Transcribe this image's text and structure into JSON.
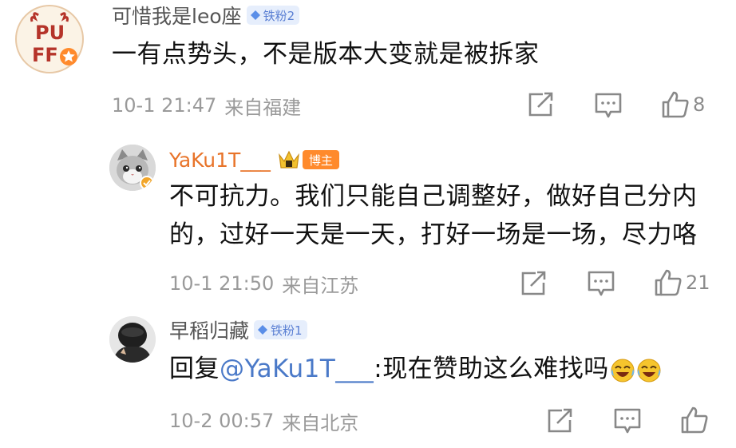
{
  "comments": [
    {
      "username": "可惜我是leo座",
      "fan_badge": "铁粉2",
      "avatar_text": "PUFF",
      "text": "一有点势头，不是版本大变就是被拆家",
      "time": "10-1 21:47",
      "location": "来自福建",
      "like_count": "8"
    },
    {
      "username": "YaKu1T___",
      "author_badge": "博主",
      "text_line1": "不可抗力。我们只能自己调整好，做好自己分内",
      "text_line2": "的，过好一天是一天，打好一场是一场，尽力咯",
      "time": "10-1 21:50",
      "location": "来自江苏",
      "like_count": "21"
    },
    {
      "username": "早稻归藏",
      "fan_badge": "铁粉1",
      "reply_prefix": "回复",
      "mention": "@YaKu1T___",
      "text": ":现在赞助这么难找吗",
      "time": "10-2 00:57",
      "location": "来自北京",
      "like_count": ""
    }
  ],
  "colors": {
    "author_name": "#e8742a",
    "mention": "#4a79c8",
    "fan_badge_bg": "#e6eefc",
    "host_badge_bg": "#ff8a2c",
    "meta": "#9a9a9a"
  },
  "icons": [
    "share-icon",
    "comment-icon",
    "like-icon",
    "diamond-icon",
    "crown-icon",
    "laugh-cry-emoji"
  ]
}
